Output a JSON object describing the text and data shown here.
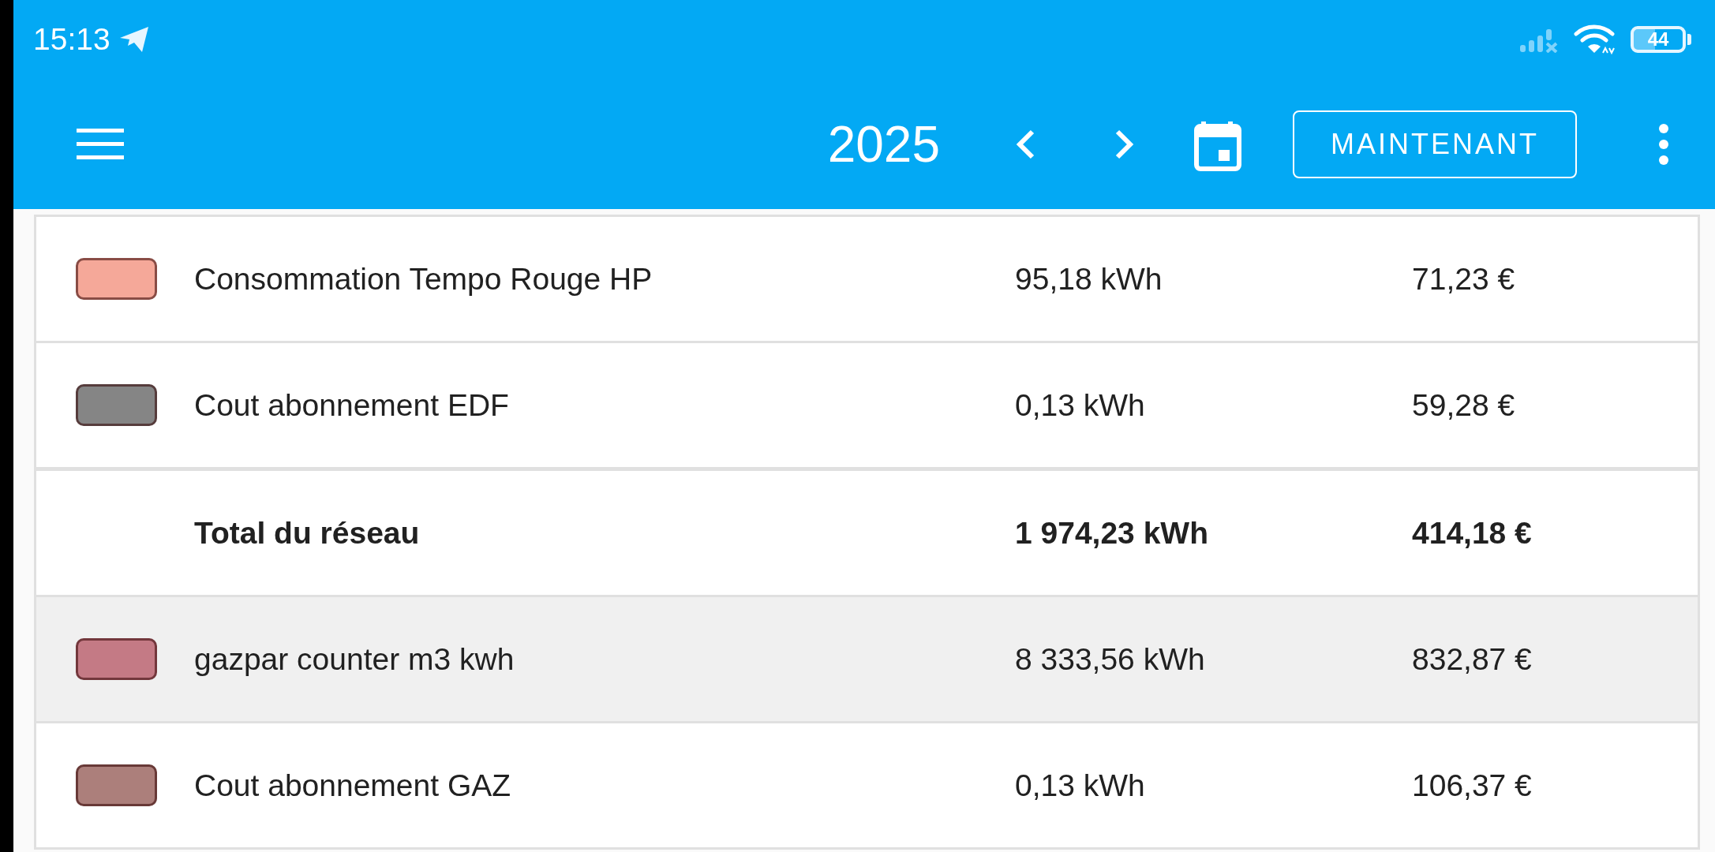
{
  "status_bar": {
    "time": "15:13",
    "battery": "44"
  },
  "app_bar": {
    "year": "2025",
    "now_button": "MAINTENANT"
  },
  "rows": [
    {
      "kind": "source",
      "name": "Consommation Tempo Rouge HP",
      "energy": "95,18 kWh",
      "cost": "71,23 €",
      "color": "#f5a899",
      "selected": false
    },
    {
      "kind": "source",
      "name": "Cout abonnement EDF",
      "energy": "0,13 kWh",
      "cost": "59,28 €",
      "color": "#858585",
      "selected": false
    },
    {
      "kind": "total",
      "name": "Total du réseau",
      "energy": "1 974,23 kWh",
      "cost": "414,18 €",
      "selected": false
    },
    {
      "kind": "source",
      "name": "gazpar counter m3 kwh",
      "energy": "8 333,56 kWh",
      "cost": "832,87 €",
      "color": "#c47a85",
      "selected": true
    },
    {
      "kind": "source",
      "name": "Cout abonnement GAZ",
      "energy": "0,13 kWh",
      "cost": "106,37 €",
      "color": "#ac7f7b",
      "selected": false
    }
  ]
}
